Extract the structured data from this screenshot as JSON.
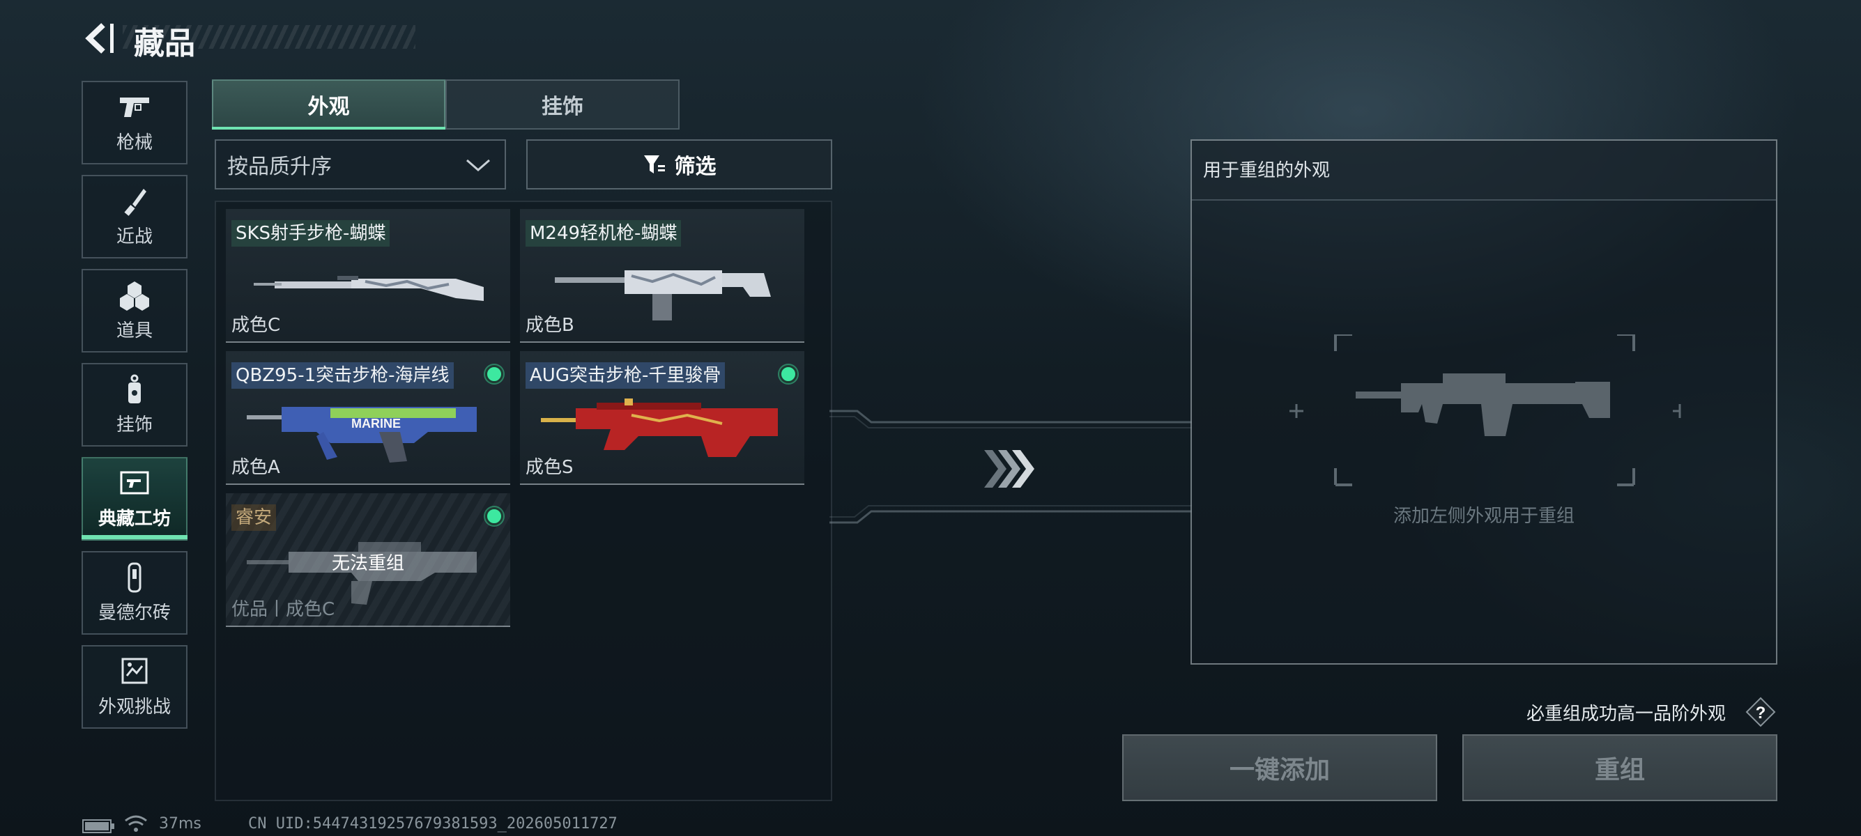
{
  "header": {
    "title": "藏品",
    "back_icon": "back-arrow-icon"
  },
  "nav": {
    "items": [
      {
        "label": "枪械",
        "icon": "pistol-icon"
      },
      {
        "label": "近战",
        "icon": "knife-icon"
      },
      {
        "label": "道具",
        "icon": "grenades-icon"
      },
      {
        "label": "挂饰",
        "icon": "charm-icon"
      },
      {
        "label": "典藏工坊",
        "icon": "workshop-icon",
        "active": true
      },
      {
        "label": "曼德尔砖",
        "icon": "mandel-brick-icon"
      },
      {
        "label": "外观挑战",
        "icon": "challenge-icon"
      }
    ]
  },
  "tabs": {
    "skin": "外观",
    "pendant": "挂饰",
    "active": "外观"
  },
  "sort": {
    "selected": "按品质升序"
  },
  "filter": {
    "label": "筛选"
  },
  "items": [
    {
      "name": "SKS射手步枪-蝴蝶",
      "grade": "成色C",
      "equipped": false
    },
    {
      "name": "M249轻机枪-蝴蝶",
      "grade": "成色B",
      "equipped": false
    },
    {
      "name": "QBZ95-1突击步枪-海岸线",
      "grade": "成色A",
      "equipped": true
    },
    {
      "name": "AUG突击步枪-千里骏骨",
      "grade": "成色S",
      "equipped": true
    },
    {
      "name": "睿安",
      "grade": "优品丨成色C",
      "equipped": true,
      "status": "无法重组",
      "locked": true
    }
  ],
  "recombine": {
    "panel_title": "用于重组的外观",
    "placeholder": "添加左侧外观用于重组",
    "note": "必重组成功高一品阶外观",
    "add_all_button": "一键添加",
    "recombine_button": "重组"
  },
  "status_bar": {
    "ping": "37ms",
    "uid": "CN UID:54474319257679381593_202605011727"
  },
  "colors": {
    "accent": "#6fe3b1",
    "dot": "#3de8a0",
    "panel_border": "#bec8ce"
  }
}
